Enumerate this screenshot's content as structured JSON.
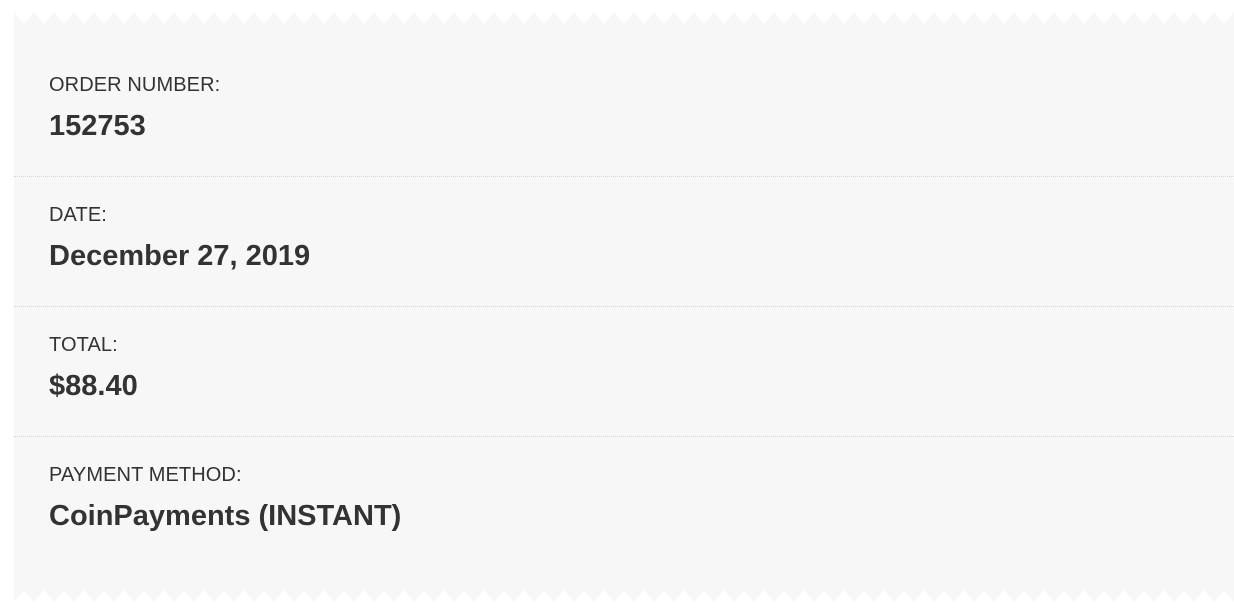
{
  "order_details": {
    "order_number": {
      "label": "ORDER NUMBER:",
      "value": "152753"
    },
    "date": {
      "label": "DATE:",
      "value": "December 27, 2019"
    },
    "total": {
      "label": "TOTAL:",
      "value": "$88.40"
    },
    "payment_method": {
      "label": "PAYMENT METHOD:",
      "value": "CoinPayments (INSTANT)"
    }
  },
  "colors": {
    "background": "#f7f7f7",
    "text": "#333333",
    "divider": "#d6d6d6"
  }
}
